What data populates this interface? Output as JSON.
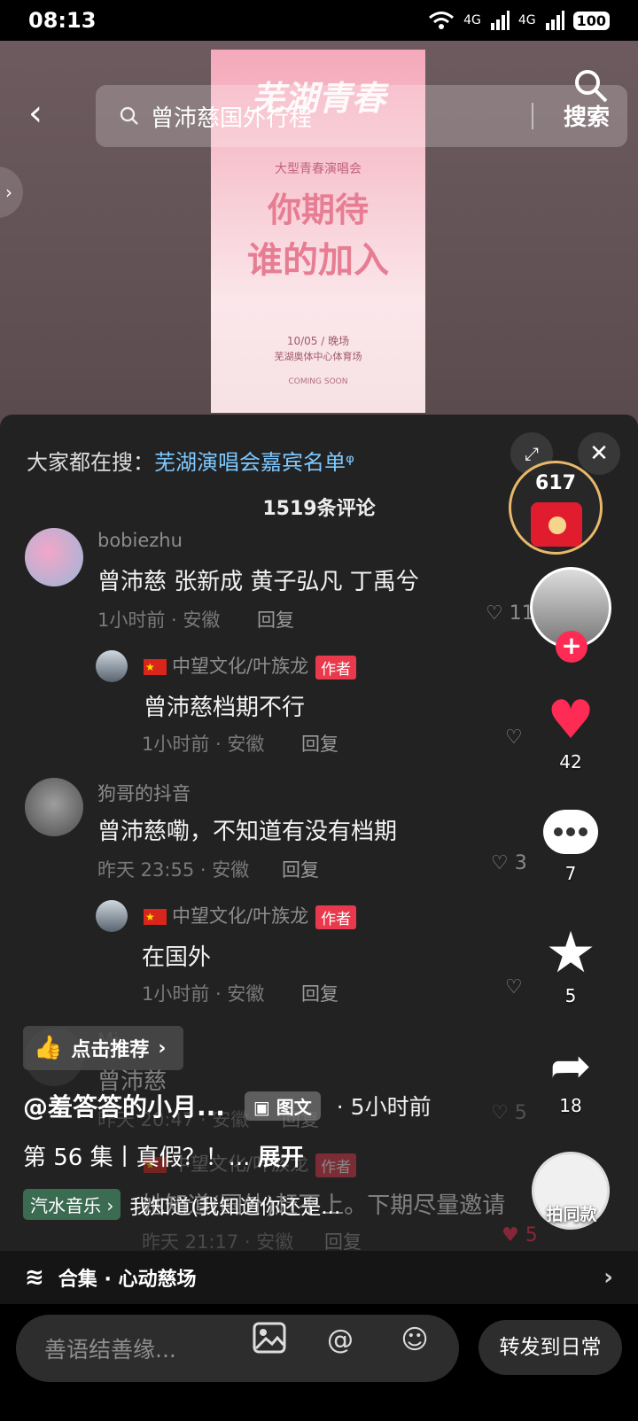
{
  "status": {
    "time": "08:13",
    "signal1": "4G",
    "signal2": "4G",
    "battery": "100"
  },
  "search": {
    "query": "曾沛慈国外行程",
    "button": "搜索"
  },
  "poster": {
    "title": "芜湖青春",
    "tagline": "大型青春演唱会",
    "headline1": "你期待",
    "headline2": "谁的加入",
    "date": "10/05 / 晚场",
    "venue": "芜湖奥体中心体育场",
    "footer": "COMING SOON"
  },
  "panel": {
    "suggest_prefix": "大家都在搜：",
    "suggest_link": "芜湖演唱会嘉宾名单",
    "comment_count": "1519条评论"
  },
  "comments": [
    {
      "user": "bobiezhu",
      "text": "曾沛慈 张新成 黄子弘凡 丁禹兮",
      "meta": "1小时前 · 安徽",
      "reply": "回复",
      "likes": "11"
    },
    {
      "user": "中望文化/叶族龙",
      "badge": "作者",
      "text": "曾沛慈档期不行",
      "meta": "1小时前 · 安徽",
      "reply": "回复",
      "likes": ""
    },
    {
      "user": "狗哥的抖音",
      "text": "曾沛慈嘞，不知道有没有档期",
      "meta": "昨天 23:55 · 安徽",
      "reply": "回复",
      "likes": "3"
    },
    {
      "user": "中望文化/叶族龙",
      "badge": "作者",
      "text": "在国外",
      "meta": "1小时前 · 安徽",
      "reply": "回复",
      "likes": ""
    },
    {
      "user": "Mi",
      "text": "曾沛慈",
      "meta": "昨天 20:47 · 安徽",
      "reply": "回复",
      "likes": "5"
    },
    {
      "user": "中望文化/叶族龙",
      "badge": "作者",
      "text": "她知道(国外)赶不上。下期尽量邀请",
      "meta": "昨天 21:17 · 安徽",
      "reply": "回复",
      "likes": "5"
    }
  ],
  "rail": {
    "red_packet": "617",
    "likes": "42",
    "comments": "7",
    "favorites": "5",
    "shares": "18",
    "music_label": "拍同款"
  },
  "video": {
    "recommend": "点击推荐",
    "author": "@羞答答的小月...",
    "type_tag": "图文",
    "ago": "· 5小时前",
    "desc": "第 56 集丨真假？！...",
    "expand": "展开",
    "music_tag": "汽水音乐",
    "music_text": "我知道(我知道你还是..."
  },
  "collection": {
    "label": "合集 · 心动慈场"
  },
  "bottom": {
    "placeholder": "善语结善缘...",
    "forward": "转发到日常"
  },
  "colors": {
    "accent": "#fe2c55",
    "link": "#7ec8ff",
    "panel": "#222222"
  }
}
